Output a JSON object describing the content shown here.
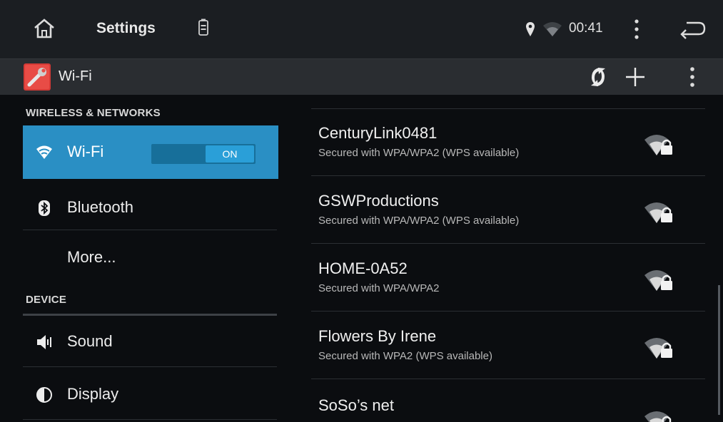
{
  "status_bar": {
    "title": "Settings",
    "time": "00:41",
    "icons": [
      "home-icon",
      "battery-icon",
      "location-icon",
      "wifi-signal-icon",
      "overflow-menu-icon",
      "back-icon"
    ]
  },
  "action_bar": {
    "title": "Wi-Fi",
    "icons": [
      "settings-app-icon",
      "wps-icon",
      "add-network-icon",
      "overflow-menu-icon"
    ]
  },
  "sidebar": {
    "section_wireless": "WIRELESS & NETWORKS",
    "section_device": "DEVICE",
    "wifi": {
      "label": "Wi-Fi",
      "toggle": "ON"
    },
    "items": [
      {
        "label": "Bluetooth",
        "icon": "bluetooth-icon"
      },
      {
        "label": "More..."
      },
      {
        "label": "Sound",
        "icon": "sound-icon"
      },
      {
        "label": "Display",
        "icon": "display-icon"
      }
    ]
  },
  "networks": [
    {
      "ssid": "CenturyLink0481",
      "security": "Secured with WPA/WPA2 (WPS available)"
    },
    {
      "ssid": "GSWProductions",
      "security": "Secured with WPA/WPA2 (WPS available)"
    },
    {
      "ssid": "HOME-0A52",
      "security": "Secured with WPA/WPA2"
    },
    {
      "ssid": "Flowers By Irene",
      "security": "Secured with WPA2 (WPS available)"
    },
    {
      "ssid": "SoSo’s net",
      "security": ""
    }
  ],
  "colors": {
    "accent": "#2a8fc4",
    "status_bar_bg": "#1b1e22",
    "action_bar_bg": "#2a2d31",
    "background": "#0b0d10"
  }
}
